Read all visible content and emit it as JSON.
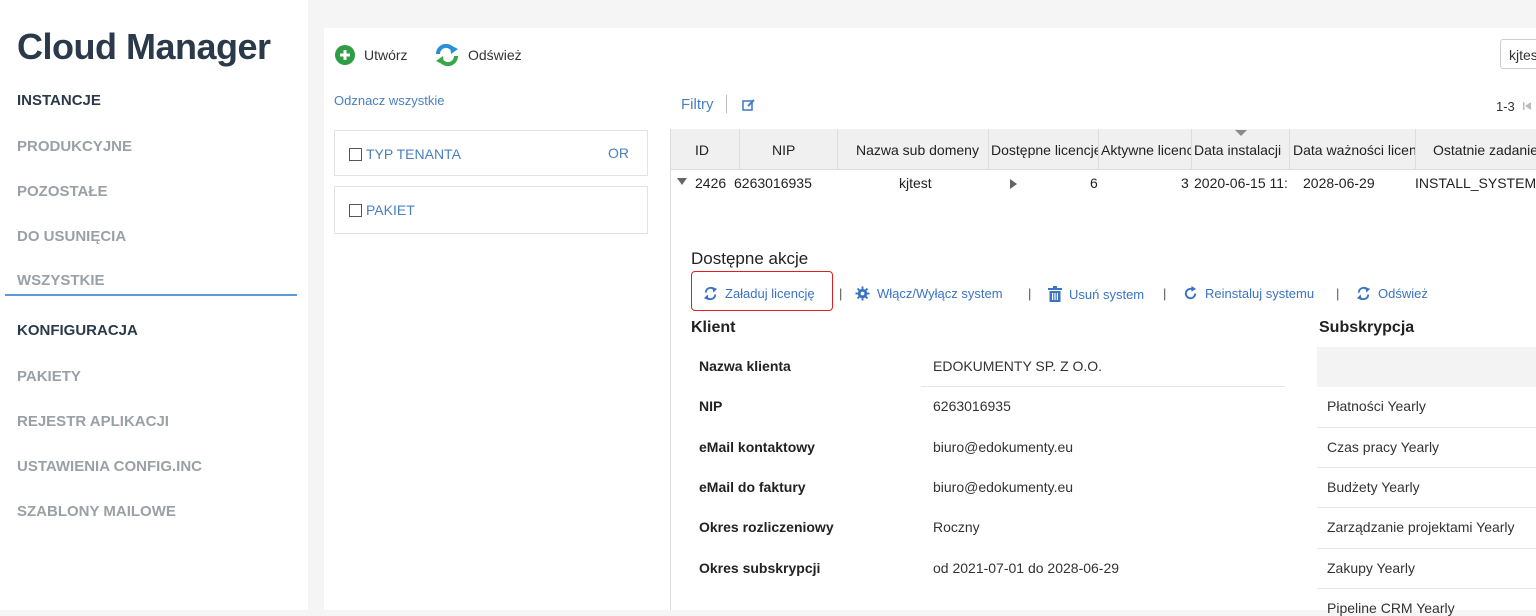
{
  "sidebar": {
    "app_title": "Cloud Manager",
    "items": [
      {
        "label": "INSTANCJE",
        "section": true
      },
      {
        "label": "PRODUKCYJNE",
        "section": false
      },
      {
        "label": "POZOSTAŁE",
        "section": false
      },
      {
        "label": "DO USUNIĘCIA",
        "section": false
      },
      {
        "label": "WSZYSTKIE",
        "section": false
      },
      {
        "label": "KONFIGURACJA",
        "section": true
      },
      {
        "label": "PAKIETY",
        "section": false
      },
      {
        "label": "REJESTR APLIKACJI",
        "section": false
      },
      {
        "label": "USTAWIENIA CONFIG.INC",
        "section": false
      },
      {
        "label": "SZABLONY MAILOWE",
        "section": false
      }
    ]
  },
  "toolbar": {
    "create_label": "Utwórz",
    "refresh_label": "Odśwież",
    "search_value": "kjtes"
  },
  "filters": {
    "uncheck_all": "Odznacz wszystkie",
    "tenant_type": "TYP TENANTA",
    "or": "OR",
    "package": "PAKIET",
    "filtry": "Filtry"
  },
  "pager": {
    "range": "1-3"
  },
  "grid": {
    "columns": [
      "ID",
      "NIP",
      "Nazwa sub domeny",
      "Dostępne licencje",
      "Aktywne licencje",
      "Data instalacji",
      "Data ważności licencji",
      "Ostatnie zadanie"
    ],
    "row": {
      "id": "2426",
      "nip": "6263016935",
      "subdomain": "kjtest",
      "available": "6",
      "active": "3",
      "install_date": "2020-06-15 11:",
      "expiry": "2028-06-29",
      "last_task": "INSTALL_SYSTEM"
    }
  },
  "details": {
    "actions_title": "Dostępne akcje",
    "actions": {
      "load_license": "Załaduj licencję",
      "toggle_system": "Włącz/Wyłącz system",
      "delete_system": "Usuń system",
      "reinstall": "Reinstaluj systemu",
      "refresh": "Odśwież"
    },
    "separator": "|",
    "client_title": "Klient",
    "client": {
      "name_label": "Nazwa klienta",
      "name_value": "EDOKUMENTY SP. Z O.O.",
      "nip_label": "NIP",
      "nip_value": "6263016935",
      "email_label": "eMail kontaktowy",
      "email_value": "biuro@edokumenty.eu",
      "invoice_email_label": "eMail do faktury",
      "invoice_email_value": "biuro@edokumenty.eu",
      "period_label": "Okres rozliczeniowy",
      "period_value": "Roczny",
      "subscription_label": "Okres subskrypcji",
      "subscription_value": "od 2021-07-01 do 2028-06-29"
    },
    "subscription_title": "Subskrypcja",
    "subscriptions": [
      "Płatności Yearly",
      "Czas pracy Yearly",
      "Budżety Yearly",
      "Zarządzanie projektami Yearly",
      "Zakupy Yearly",
      "Pipeline CRM Yearly"
    ]
  },
  "colors": {
    "accent": "#4a7fc1",
    "highlight": "#e02020",
    "green": "#2e9e44"
  }
}
